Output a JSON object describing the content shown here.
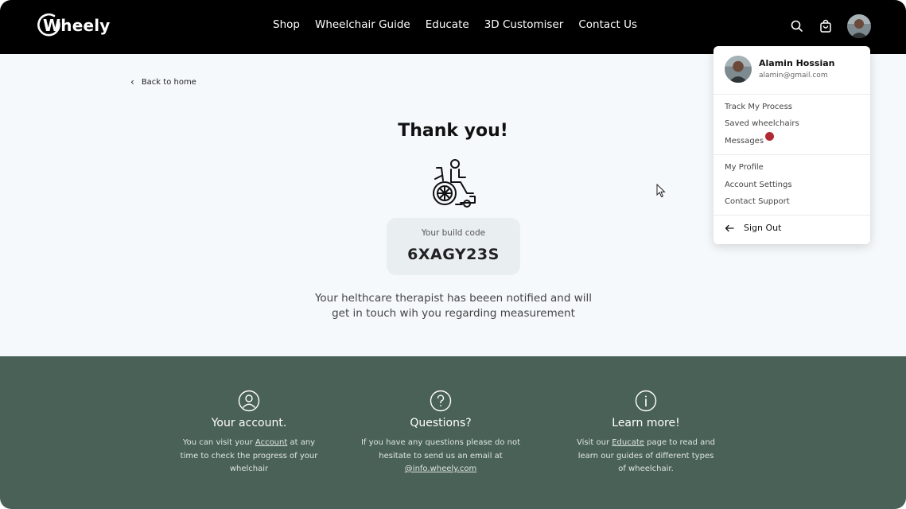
{
  "brand": {
    "logo_text": "Wheely"
  },
  "nav": {
    "links": [
      "Shop",
      "Wheelchair Guide",
      "Educate",
      "3D Customiser",
      "Contact Us"
    ],
    "icons": [
      "search-icon",
      "cart-icon"
    ]
  },
  "main": {
    "back_label": "Back to home",
    "title": "Thank you!",
    "build_code_label": "Your build code",
    "build_code": "6XAGY23S",
    "notice_line1": "Your helthcare therapist has beeen notified and will",
    "notice_line2": "get in touch wih you regarding measurement"
  },
  "footer": {
    "columns": [
      {
        "icon": "user-icon",
        "title": "Your account.",
        "lines": [
          "You can visit your ",
          "Account",
          " at any",
          "time to check the progress of your",
          "whelchair"
        ]
      },
      {
        "icon": "question-icon",
        "title": "Questions?",
        "lines": [
          "If you have any questions please do not",
          "hesitate to send us an email at",
          "@info.wheely.com"
        ]
      },
      {
        "icon": "info-icon",
        "title": "Learn more!",
        "lines": [
          "Visit our ",
          "Educate",
          " page to read and",
          "learn our guides of different types",
          "of wheelchair."
        ]
      }
    ]
  },
  "dropdown": {
    "user_name": "Alamin Hossian",
    "user_email": "alamin@gmail.com",
    "items_group1": [
      "Track My Process",
      "Saved wheelchairs",
      "Messages"
    ],
    "items_group2": [
      "My Profile",
      "Account Settings",
      "Contact Support"
    ],
    "sign_out": "Sign Out",
    "badge_color": "#b02a33"
  },
  "colors": {
    "nav_bg": "#000000",
    "page_bg": "#f5f9fb",
    "footer_bg": "#4a6157",
    "code_box_bg": "#e9eef1"
  }
}
